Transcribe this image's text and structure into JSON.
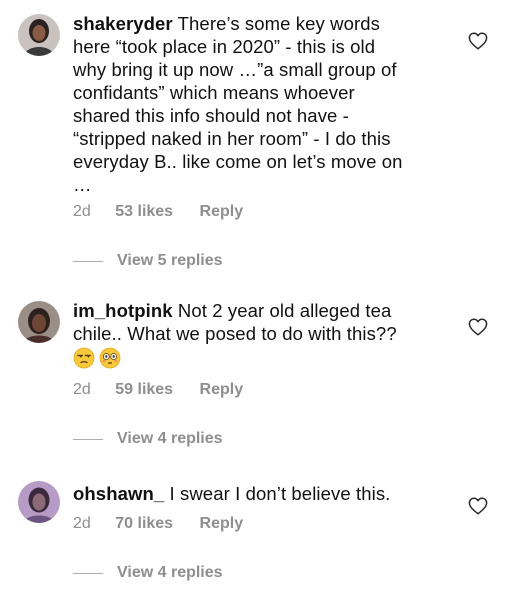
{
  "comments": [
    {
      "username": "shakeryder",
      "text_lines": [
        "There’s some key words",
        "here “took place in 2020” - this is old",
        "why bring it up now …”a small group of",
        "confidants”  which means whoever",
        "shared this info should not have -",
        "“stripped naked in her room” - I do this",
        "everyday B.. like come on let’s move on",
        "…"
      ],
      "time": "2d",
      "likes": "53 likes",
      "reply_label": "Reply",
      "view_replies": "View 5 replies",
      "like_icon": "heart-outline-icon"
    },
    {
      "username": "im_hotpink",
      "text_lines": [
        "Not 2 year old alleged tea",
        "chile.. What we posed to do with this??"
      ],
      "emojis": [
        "unamused-face",
        "flushed-face"
      ],
      "time": "2d",
      "likes": "59 likes",
      "reply_label": "Reply",
      "view_replies": "View 4 replies",
      "like_icon": "heart-outline-icon"
    },
    {
      "username": "ohshawn_",
      "text_lines": [
        "I swear I don’t believe this."
      ],
      "time": "2d",
      "likes": "70 likes",
      "reply_label": "Reply",
      "view_replies": "View 4 replies",
      "like_icon": "heart-outline-icon"
    }
  ],
  "colors": {
    "text": "#111111",
    "meta": "#8e8e8e"
  }
}
